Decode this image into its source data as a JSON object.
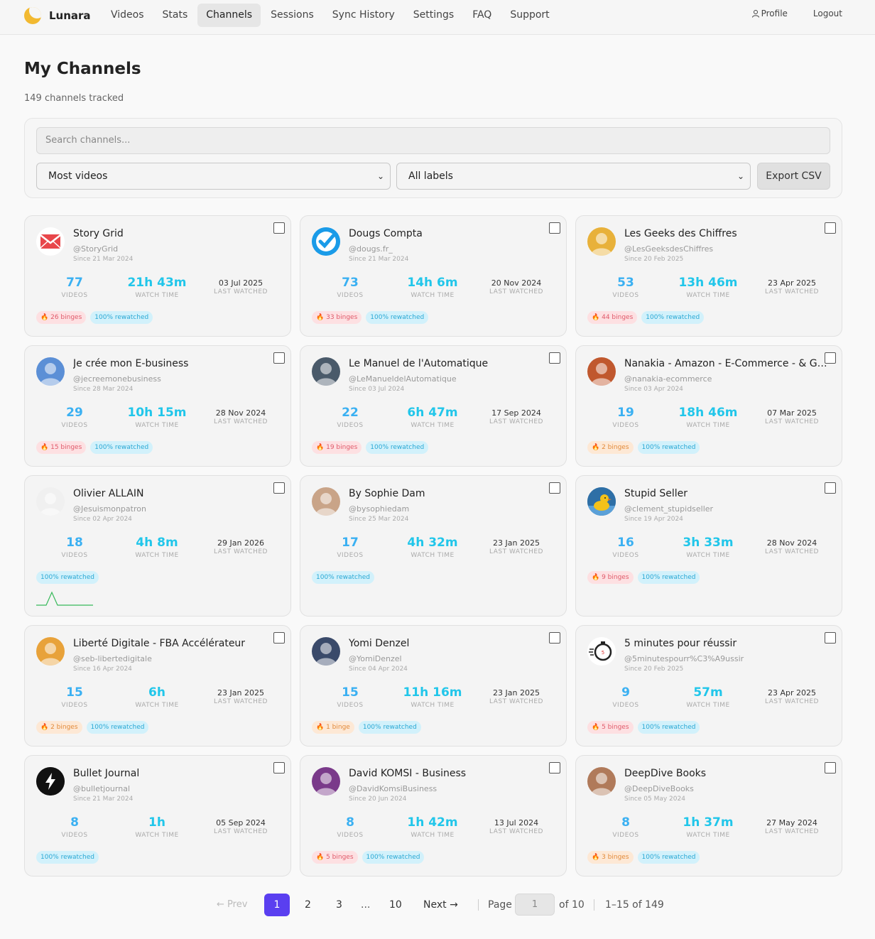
{
  "brand": "Lunara",
  "nav": [
    "Videos",
    "Stats",
    "Channels",
    "Sessions",
    "Sync History",
    "Settings",
    "FAQ",
    "Support"
  ],
  "active_nav": "Channels",
  "nav_right": {
    "profile": "Profile",
    "logout": "Logout"
  },
  "page": {
    "title": "My Channels",
    "subtitle": "149 channels tracked"
  },
  "filters": {
    "search_placeholder": "Search channels...",
    "sort": "Most videos",
    "labels": "All labels",
    "export": "Export CSV"
  },
  "labels": {
    "videos": "VIDEOS",
    "watch_time": "WATCH TIME",
    "last_watched": "LAST WATCHED"
  },
  "channels": [
    {
      "name": "Story Grid",
      "handle": "@StoryGrid",
      "since": "Since 21 Mar 2024",
      "videos": "77",
      "watch": "21h 43m",
      "last": "03 Jul 2025",
      "binges": "26 binges",
      "binge_color": "red",
      "rewatch": "100% rewatched",
      "avatar_icon": "mail-icon",
      "avatar_bg": "#ffffff"
    },
    {
      "name": "Dougs Compta",
      "handle": "@dougs.fr_",
      "since": "Since 21 Mar 2024",
      "videos": "73",
      "watch": "14h 6m",
      "last": "20 Nov 2024",
      "binges": "33 binges",
      "binge_color": "red",
      "rewatch": "100% rewatched",
      "avatar_icon": "check-icon",
      "avatar_bg": "#1a9be8"
    },
    {
      "name": "Les Geeks des Chiffres",
      "handle": "@LesGeeksdesChiffres",
      "since": "Since 20 Feb 2025",
      "videos": "53",
      "watch": "13h 46m",
      "last": "23 Apr 2025",
      "binges": "44 binges",
      "binge_color": "red",
      "rewatch": "100% rewatched",
      "avatar_icon": "person-icon",
      "avatar_bg": "#e8b13a"
    },
    {
      "name": "Je crée mon E-business",
      "handle": "@jecreemonebusiness",
      "since": "Since 28 Mar 2024",
      "videos": "29",
      "watch": "10h 15m",
      "last": "28 Nov 2024",
      "binges": "15 binges",
      "binge_color": "red",
      "rewatch": "100% rewatched",
      "avatar_icon": "person-icon",
      "avatar_bg": "#5b8fd6"
    },
    {
      "name": "Le Manuel de l'Automatique",
      "handle": "@LeManueldelAutomatique",
      "since": "Since 03 Jul 2024",
      "videos": "22",
      "watch": "6h 47m",
      "last": "17 Sep 2024",
      "binges": "19 binges",
      "binge_color": "red",
      "rewatch": "100% rewatched",
      "avatar_icon": "person-icon",
      "avatar_bg": "#4a5a6a"
    },
    {
      "name": "Nanakia - Amazon - E-Commerce - & Growth Hacking",
      "handle": "@nanakia-ecommerce",
      "since": "Since 03 Apr 2024",
      "videos": "19",
      "watch": "18h 46m",
      "last": "07 Mar 2025",
      "binges": "2 binges",
      "binge_color": "orange",
      "rewatch": "100% rewatched",
      "avatar_icon": "person-icon",
      "avatar_bg": "#c0582e"
    },
    {
      "name": "Olivier ALLAIN",
      "handle": "@Jesuismonpatron",
      "since": "Since 02 Apr 2024",
      "videos": "18",
      "watch": "4h 8m",
      "last": "29 Jan 2026",
      "binges": "",
      "binge_color": "",
      "rewatch": "100% rewatched",
      "avatar_icon": "person-icon",
      "avatar_bg": "#f0f0f0",
      "sparkline": true
    },
    {
      "name": "By Sophie Dam",
      "handle": "@bysophiedam",
      "since": "Since 25 Mar 2024",
      "videos": "17",
      "watch": "4h 32m",
      "last": "23 Jan 2025",
      "binges": "",
      "binge_color": "",
      "rewatch": "100% rewatched",
      "avatar_icon": "person-icon",
      "avatar_bg": "#c9a488"
    },
    {
      "name": "Stupid Seller",
      "handle": "@clement_stupidseller",
      "since": "Since 19 Apr 2024",
      "videos": "16",
      "watch": "3h 33m",
      "last": "28 Nov 2024",
      "binges": "9 binges",
      "binge_color": "red",
      "rewatch": "100% rewatched",
      "avatar_icon": "duck-icon",
      "avatar_bg": "#2e6fa6"
    },
    {
      "name": "Liberté Digitale - FBA Accélérateur",
      "handle": "@seb-libertedigitale",
      "since": "Since 16 Apr 2024",
      "videos": "15",
      "watch": "6h",
      "last": "23 Jan 2025",
      "binges": "2 binges",
      "binge_color": "orange",
      "rewatch": "100% rewatched",
      "avatar_icon": "person-icon",
      "avatar_bg": "#e8a23a"
    },
    {
      "name": "Yomi Denzel",
      "handle": "@YomiDenzel",
      "since": "Since 04 Apr 2024",
      "videos": "15",
      "watch": "11h 16m",
      "last": "23 Jan 2025",
      "binges": "1 binge",
      "binge_color": "orange",
      "rewatch": "100% rewatched",
      "avatar_icon": "person-icon",
      "avatar_bg": "#3a4a6a"
    },
    {
      "name": "5 minutes pour réussir",
      "handle": "@5minutespourr%C3%A9ussir",
      "since": "Since 20 Feb 2025",
      "videos": "9",
      "watch": "57m",
      "last": "23 Apr 2025",
      "binges": "5 binges",
      "binge_color": "red",
      "rewatch": "100% rewatched",
      "avatar_icon": "stopwatch-icon",
      "avatar_bg": "#ffffff"
    },
    {
      "name": "Bullet Journal",
      "handle": "@bulletjournal",
      "since": "Since 21 Mar 2024",
      "videos": "8",
      "watch": "1h",
      "last": "05 Sep 2024",
      "binges": "",
      "binge_color": "",
      "rewatch": "100% rewatched",
      "avatar_icon": "lightning-icon",
      "avatar_bg": "#111111"
    },
    {
      "name": "David KOMSI - Business",
      "handle": "@DavidKomsiBusiness",
      "since": "Since 20 Jun 2024",
      "videos": "8",
      "watch": "1h 42m",
      "last": "13 Jul 2024",
      "binges": "5 binges",
      "binge_color": "red",
      "rewatch": "100% rewatched",
      "avatar_icon": "person-icon",
      "avatar_bg": "#7a3a8a"
    },
    {
      "name": "DeepDive Books",
      "handle": "@DeepDiveBooks",
      "since": "Since 05 May 2024",
      "videos": "8",
      "watch": "1h 37m",
      "last": "27 May 2024",
      "binges": "3 binges",
      "binge_color": "orange",
      "rewatch": "100% rewatched",
      "avatar_icon": "person-icon",
      "avatar_bg": "#b07a5a"
    }
  ],
  "pagination": {
    "prev": "← Prev",
    "pages": [
      "1",
      "2",
      "3",
      "...",
      "10"
    ],
    "current": "1",
    "next": "Next →",
    "page_label": "Page",
    "page_input": "1",
    "of": "of 10",
    "range": "1–15 of 149"
  }
}
